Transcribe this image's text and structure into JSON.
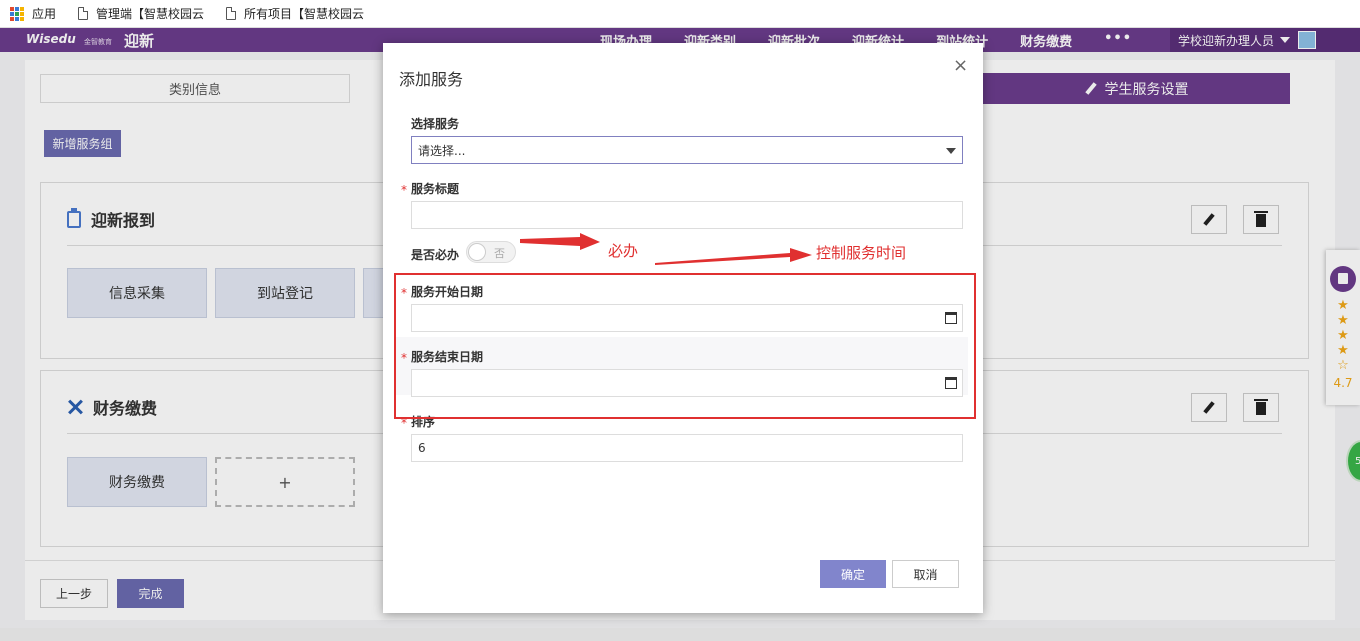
{
  "bookmarks": {
    "apps": "应用",
    "item1": "管理端【智慧校园云",
    "item2": "所有项目【智慧校园云"
  },
  "appbar": {
    "logo": "Wisedu",
    "logo_sub": "金智教育",
    "title": "迎新",
    "nav": [
      "现场办理",
      "迎新类别",
      "迎新批次",
      "迎新统计",
      "到站统计",
      "财务缴费"
    ],
    "more": "•••",
    "user": "学校迎新办理人员"
  },
  "page": {
    "step_inactive": "类别信息",
    "step_active": "学生服务设置",
    "add_group_button": "新增服务组",
    "panel1": {
      "title": "迎新报到",
      "tiles": [
        "信息采集",
        "到站登记"
      ]
    },
    "panel2": {
      "title": "财务缴费",
      "tiles": [
        "财务缴费"
      ],
      "add": "+"
    },
    "prev_button": "上一步",
    "done_button": "完成"
  },
  "rating": {
    "stars": [
      "★",
      "★",
      "★",
      "★",
      "☆"
    ],
    "score": "4.7"
  },
  "green_badge": "5",
  "modal": {
    "title": "添加服务",
    "close": "×",
    "select_service_label": "选择服务",
    "select_service_placeholder": "请选择...",
    "required_mark": "*",
    "service_title_label": "服务标题",
    "service_title_value": "",
    "mandatory_label": "是否必办",
    "mandatory_toggle_text": "否",
    "start_date_label": "服务开始日期",
    "start_date_value": "",
    "end_date_label": "服务结束日期",
    "end_date_value": "",
    "order_label": "排序",
    "order_value": "6",
    "ok_button": "确定",
    "cancel_button": "取消"
  },
  "annotations": {
    "mandatory_note": "必办",
    "time_note": "控制服务时间",
    "color": "#e03030"
  },
  "colors": {
    "brand_purple": "#6b3c8c",
    "button_blue": "#8185cc"
  }
}
